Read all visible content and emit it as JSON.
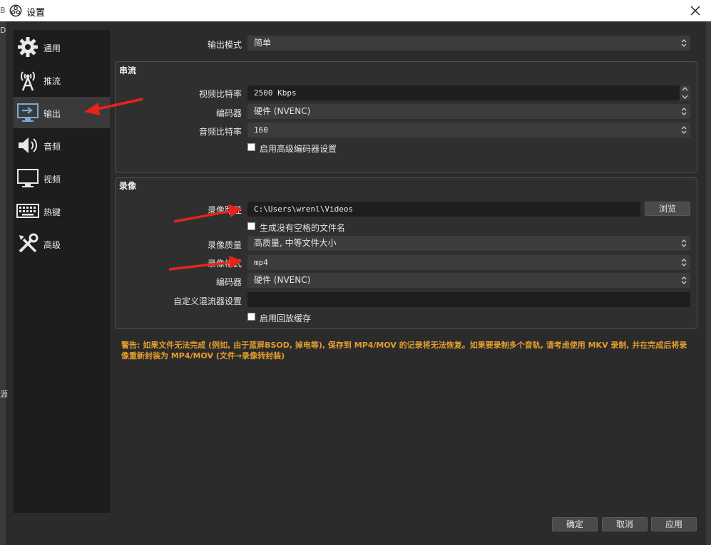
{
  "window": {
    "title": "设置"
  },
  "sidebar": {
    "items": [
      {
        "label": "通用",
        "icon": "gear-icon"
      },
      {
        "label": "推流",
        "icon": "broadcast-antenna-icon"
      },
      {
        "label": "输出",
        "icon": "monitor-output-icon",
        "active": true
      },
      {
        "label": "音频",
        "icon": "speaker-icon"
      },
      {
        "label": "视频",
        "icon": "monitor-icon"
      },
      {
        "label": "热键",
        "icon": "keyboard-icon"
      },
      {
        "label": "高级",
        "icon": "tools-icon"
      }
    ]
  },
  "output_mode": {
    "label": "输出模式",
    "value": "简单"
  },
  "streaming": {
    "title": "串流",
    "video_bitrate": {
      "label": "视频比特率",
      "value": "2500 Kbps"
    },
    "encoder": {
      "label": "编码器",
      "value": "硬件 (NVENC)"
    },
    "audio_bitrate": {
      "label": "音频比特率",
      "value": "160"
    },
    "advanced_encoder": {
      "label": "启用高级编码器设置",
      "checked": false
    }
  },
  "recording": {
    "title": "录像",
    "path": {
      "label": "录像路径",
      "value": "C:\\Users\\wrenl\\Videos",
      "browse": "浏览"
    },
    "no_space": {
      "label": "生成没有空格的文件名",
      "checked": false
    },
    "quality": {
      "label": "录像质量",
      "value": "高质量, 中等文件大小"
    },
    "format": {
      "label": "录像格式",
      "value": "mp4"
    },
    "encoder": {
      "label": "编码器",
      "value": "硬件 (NVENC)"
    },
    "muxer": {
      "label": "自定义混流器设置",
      "value": ""
    },
    "replay_buffer": {
      "label": "启用回放缓存",
      "checked": false
    }
  },
  "warning": "警告: 如果文件无法完成 (例如, 由于蓝屏BSOD, 掉电等), 保存到 MP4/MOV 的记录将无法恢复。如果要录制多个音轨, 请考虑使用 MKV 录制, 并在完成后将录像重新封装为 MP4/MOV (文件→录像转封装)",
  "buttons": {
    "ok": "确定",
    "cancel": "取消",
    "apply": "应用"
  },
  "background_fragments": {
    "top": "B",
    "mid": "D",
    "side": "源"
  },
  "colors": {
    "annotation_arrow": "#e8231a",
    "warning": "#e39d2d",
    "active_sidebar": "#3a3a3a"
  }
}
